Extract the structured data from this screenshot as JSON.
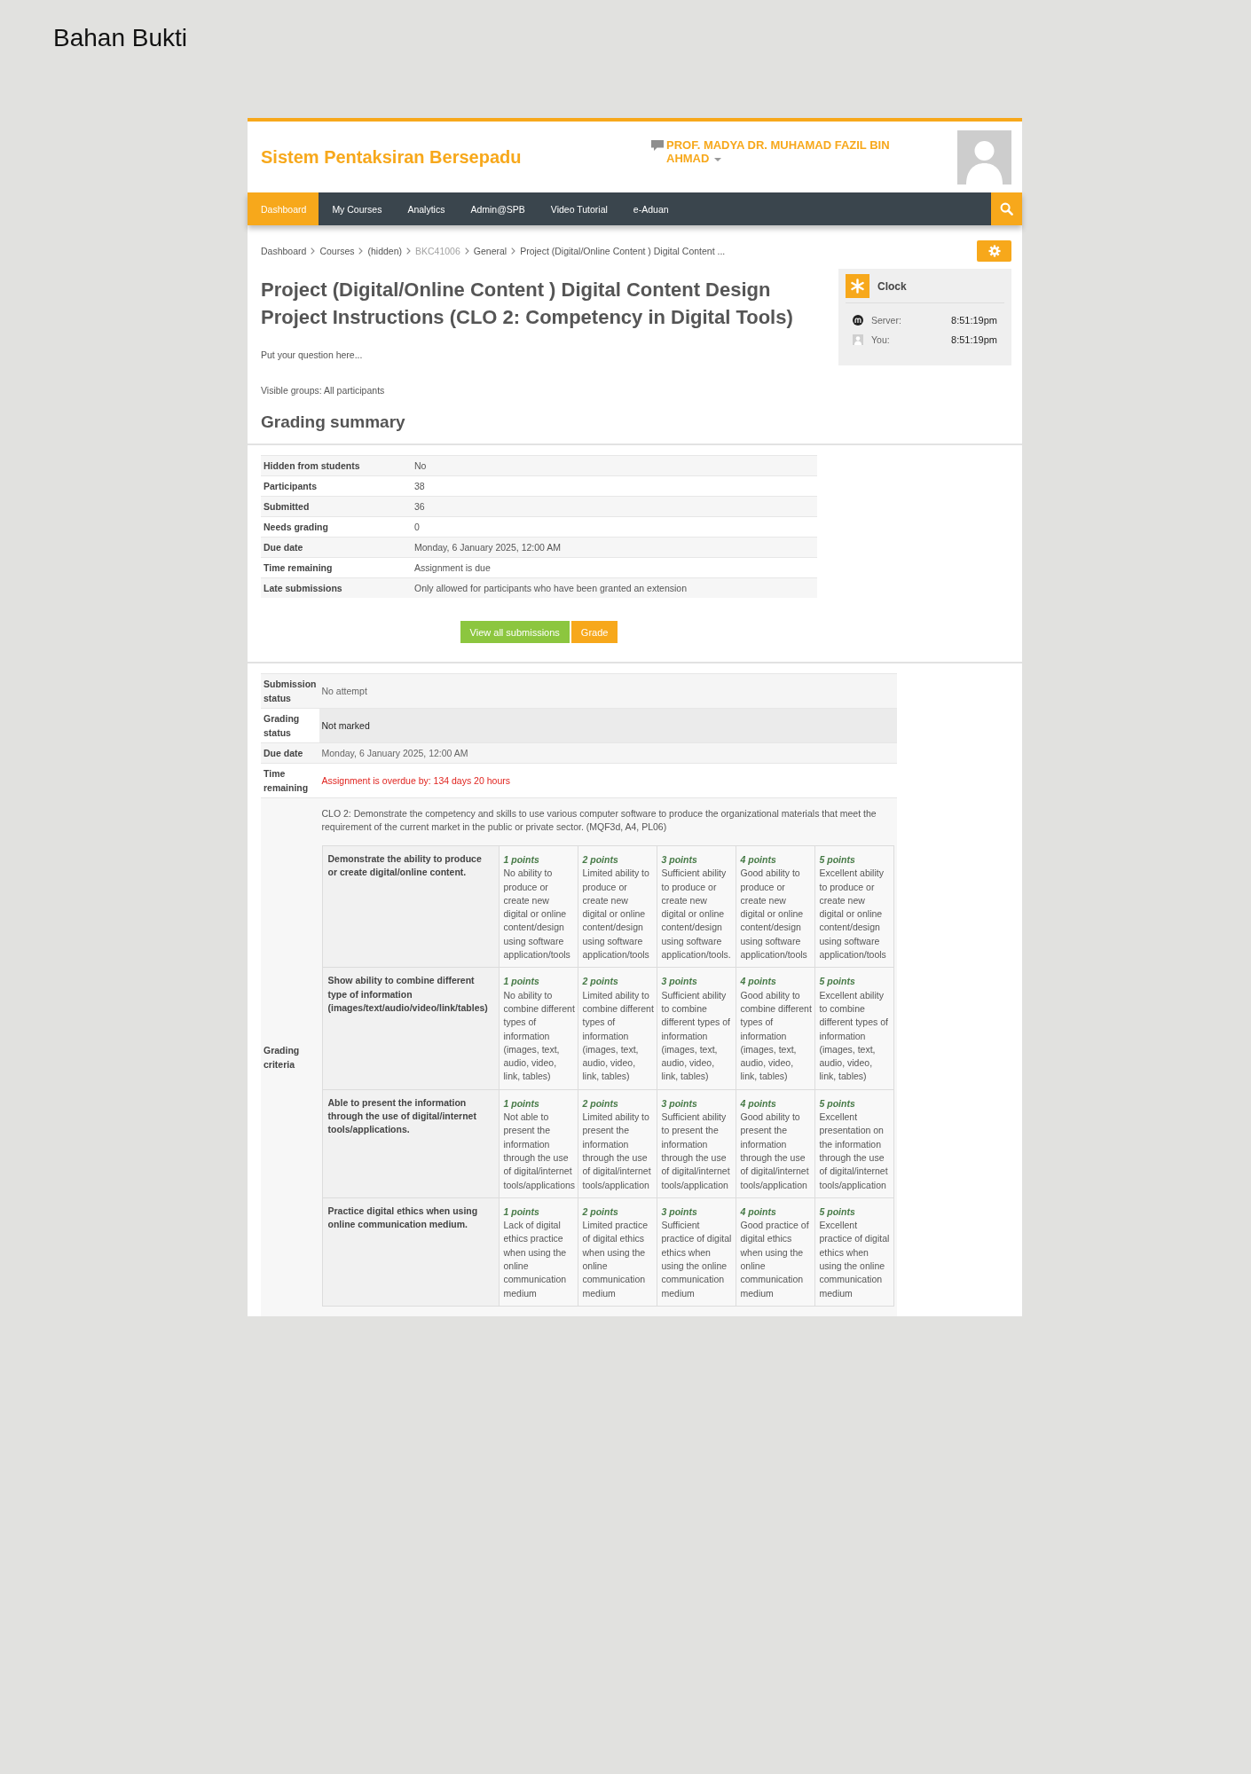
{
  "document": {
    "title": "Bahan Bukti"
  },
  "header": {
    "site_name": "Sistem Pentaksiran Bersepadu",
    "user_name": "PROF. MADYA DR. MUHAMAD FAZIL BIN AHMAD"
  },
  "nav": {
    "items": [
      {
        "label": "Dashboard",
        "selected": true
      },
      {
        "label": "My Courses",
        "selected": false
      },
      {
        "label": "Analytics",
        "selected": false
      },
      {
        "label": "Admin@SPB",
        "selected": false
      },
      {
        "label": "Video Tutorial",
        "selected": false
      },
      {
        "label": "e-Aduan",
        "selected": false
      }
    ]
  },
  "breadcrumb": [
    {
      "label": "Dashboard",
      "dimmed": false
    },
    {
      "label": "Courses",
      "dimmed": false
    },
    {
      "label": "(hidden)",
      "dimmed": false
    },
    {
      "label": "BKC41006",
      "dimmed": true
    },
    {
      "label": "General",
      "dimmed": false
    },
    {
      "label": "Project (Digital/Online Content ) Digital Content ...",
      "dimmed": false
    }
  ],
  "page": {
    "title": "Project (Digital/Online Content ) Digital Content Design Project Instructions (CLO 2: Competency in Digital Tools)",
    "question": "Put your question here...",
    "visible_groups": "Visible groups: All participants"
  },
  "clock": {
    "title": "Clock",
    "rows": [
      {
        "kind": "server",
        "label": "Server:",
        "time": "8:51:19pm"
      },
      {
        "kind": "user",
        "label": "You:",
        "time": "8:51:19pm"
      }
    ]
  },
  "grading_summary": {
    "title": "Grading summary",
    "rows": [
      {
        "label": "Hidden from students",
        "value": "No"
      },
      {
        "label": "Participants",
        "value": "38"
      },
      {
        "label": "Submitted",
        "value": "36"
      },
      {
        "label": "Needs grading",
        "value": "0"
      },
      {
        "label": "Due date",
        "value": "Monday, 6 January 2025, 12:00 AM"
      },
      {
        "label": "Time remaining",
        "value": "Assignment is due"
      },
      {
        "label": "Late submissions",
        "value": "Only allowed for participants who have been granted an extension"
      }
    ],
    "buttons": [
      {
        "label": "View all submissions",
        "kind": "primary"
      },
      {
        "label": "Grade",
        "kind": "secondary"
      }
    ]
  },
  "submission_status": {
    "rows": [
      {
        "label": "Submission status",
        "value": "No attempt",
        "kind": "plain"
      },
      {
        "label": "Grading status",
        "value": "Not marked",
        "kind": "not_graded"
      },
      {
        "label": "Due date",
        "value": "Monday, 6 January 2025, 12:00 AM",
        "kind": "plain"
      },
      {
        "label": "Time remaining",
        "value": "Assignment is overdue by: 134 days 20 hours",
        "kind": "overdue"
      }
    ],
    "grading_criteria": {
      "label": "Grading criteria",
      "description": "CLO 2: Demonstrate the competency and skills to use various computer software to produce the organizational materials that meet the requirement of the current market in the public or private sector. (MQF3d, A4, PL06)",
      "criteria": [
        {
          "description": "Demonstrate the ability to produce or create digital/online content.",
          "levels": [
            {
              "score": "1 points",
              "definition": "No ability to produce or create new digital or online content/design using software application/tools"
            },
            {
              "score": "2 points",
              "definition": "Limited ability to produce or create new digital or online content/design using software application/tools"
            },
            {
              "score": "3 points",
              "definition": "Sufficient ability to produce or create new digital or online content/design using software application/tools."
            },
            {
              "score": "4 points",
              "definition": "Good ability to produce or create new digital or online content/design using software application/tools"
            },
            {
              "score": "5 points",
              "definition": "Excellent ability to produce or create new digital or online content/design using software application/tools"
            }
          ]
        },
        {
          "description": "Show ability to combine different type of information (images/text/audio/video/link/tables)",
          "levels": [
            {
              "score": "1 points",
              "definition": "No ability to combine different types of information (images, text, audio, video, link, tables)"
            },
            {
              "score": "2 points",
              "definition": "Limited ability to combine different types of information (images, text, audio, video, link, tables)"
            },
            {
              "score": "3 points",
              "definition": "Sufficient ability to combine different types of information (images, text, audio, video, link, tables)"
            },
            {
              "score": "4 points",
              "definition": "Good ability to combine different types of information (images, text, audio, video, link, tables)"
            },
            {
              "score": "5 points",
              "definition": "Excellent ability to combine different types of information (images, text, audio, video, link, tables)"
            }
          ]
        },
        {
          "description": "Able to present the information through the use of digital/internet tools/applications.",
          "levels": [
            {
              "score": "1 points",
              "definition": "Not able to present the information through the use of digital/internet tools/applications"
            },
            {
              "score": "2 points",
              "definition": "Limited ability to present the information through the use of digital/internet tools/application"
            },
            {
              "score": "3 points",
              "definition": "Sufficient ability to present the information through the use of digital/internet tools/application"
            },
            {
              "score": "4 points",
              "definition": "Good ability to present the information through the use of digital/internet tools/application"
            },
            {
              "score": "5 points",
              "definition": "Excellent presentation on the information through the use of digital/internet tools/application"
            }
          ]
        },
        {
          "description": "Practice digital ethics when using online communication medium.",
          "levels": [
            {
              "score": "1 points",
              "definition": "Lack of digital ethics practice when using the online communication medium"
            },
            {
              "score": "2 points",
              "definition": "Limited practice of digital ethics when using the online communication medium"
            },
            {
              "score": "3 points",
              "definition": "Sufficient practice of digital ethics when using the online communication medium"
            },
            {
              "score": "4 points",
              "definition": "Good practice of digital ethics when using the online communication medium"
            },
            {
              "score": "5 points",
              "definition": "Excellent practice of digital ethics when using the online communication medium"
            }
          ]
        }
      ]
    }
  }
}
